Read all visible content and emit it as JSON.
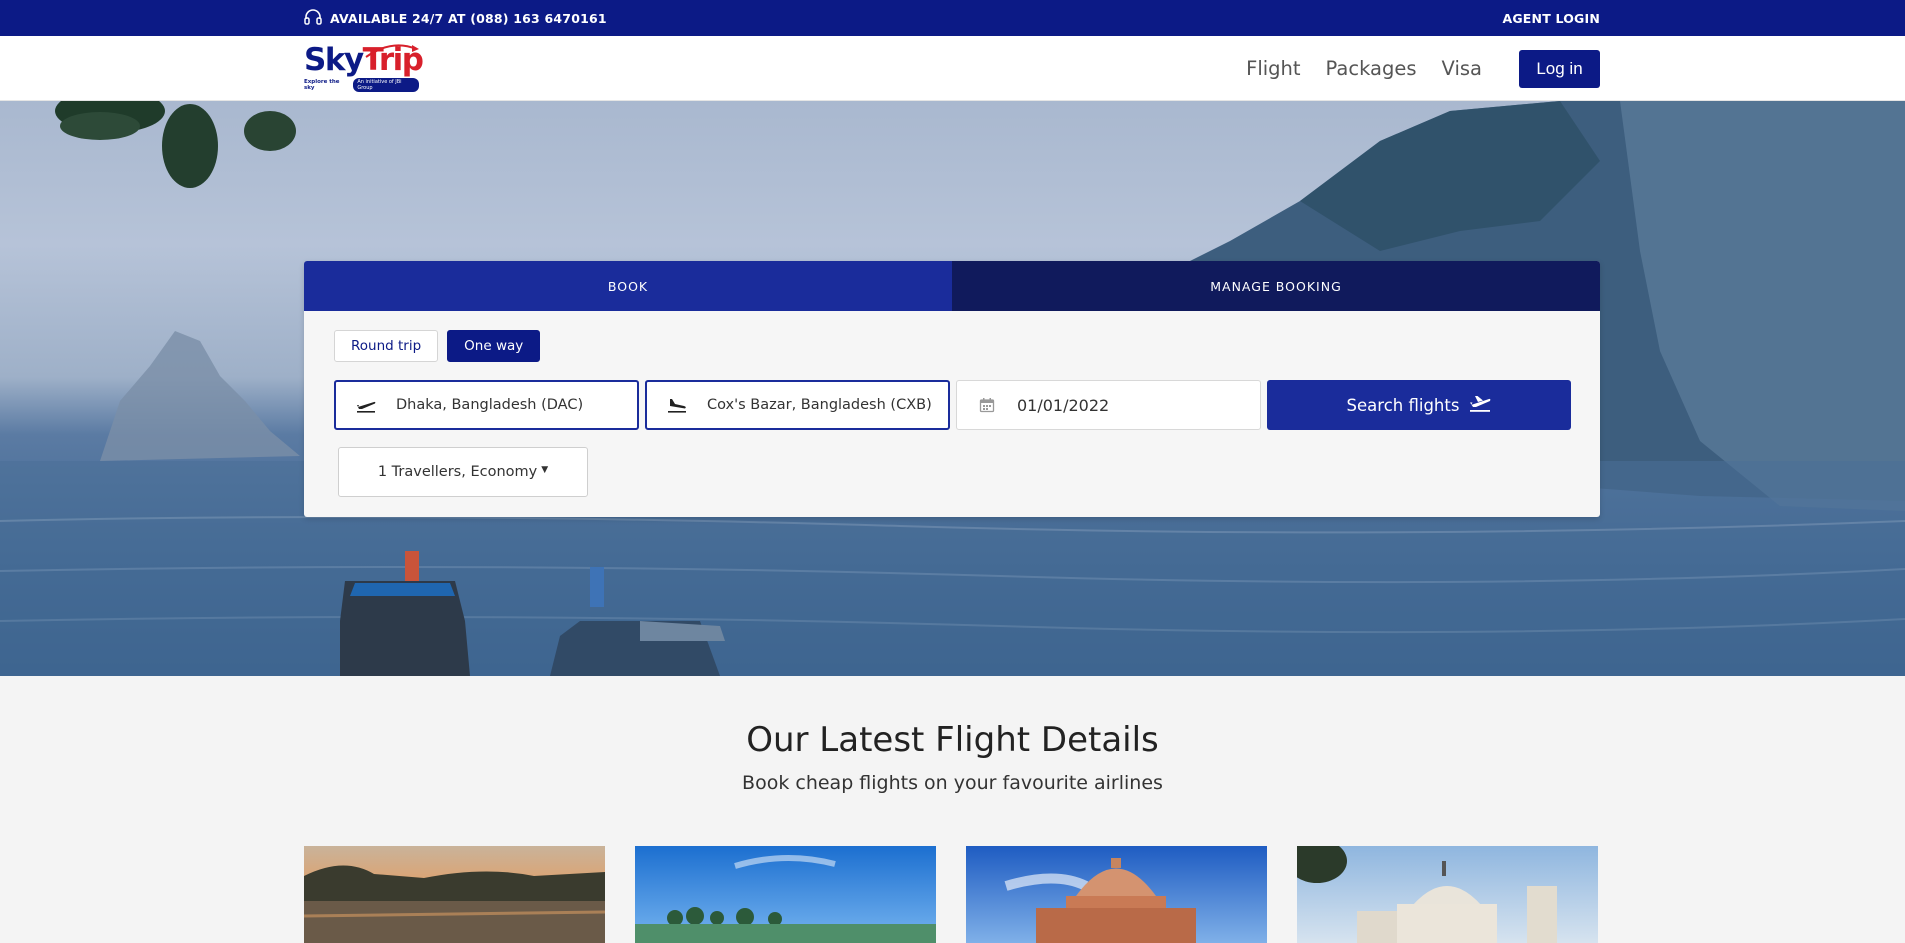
{
  "topbar": {
    "availability": "AVAILABLE 24/7 AT (088) 163 6470161",
    "agent_login": "AGENT LOGIN"
  },
  "brand": {
    "sky": "Sky",
    "trip": "Trip",
    "tagline": "Explore the sky",
    "pill": "An initiative of JBi Group"
  },
  "nav": {
    "items": [
      {
        "label": "Flight"
      },
      {
        "label": "Packages"
      },
      {
        "label": "Visa"
      }
    ],
    "login": "Log in"
  },
  "booking": {
    "tabs": [
      {
        "label": "BOOK",
        "active": true
      },
      {
        "label": "MANAGE BOOKING",
        "active": false
      }
    ],
    "trip_types": [
      {
        "label": "Round trip",
        "selected": false
      },
      {
        "label": "One way",
        "selected": true
      }
    ],
    "from": "Dhaka, Bangladesh (DAC)",
    "to": "Cox's Bazar, Bangladesh (CXB)",
    "date": "01/01/2022",
    "search_label": "Search flights",
    "travellers": "1 Travellers, Economy"
  },
  "latest": {
    "title": "Our Latest Flight Details",
    "subtitle": "Book cheap flights on your favourite airlines"
  },
  "icons": {
    "headset": "headset-icon",
    "takeoff": "plane-takeoff-icon",
    "landing": "plane-landing-icon",
    "calendar": "calendar-icon",
    "search_plane": "plane-icon"
  },
  "colors": {
    "brand_navy": "#0c1a86",
    "tab_book": "#1a2c9b",
    "tab_manage": "#101a5c",
    "brand_red": "#d8202b"
  }
}
